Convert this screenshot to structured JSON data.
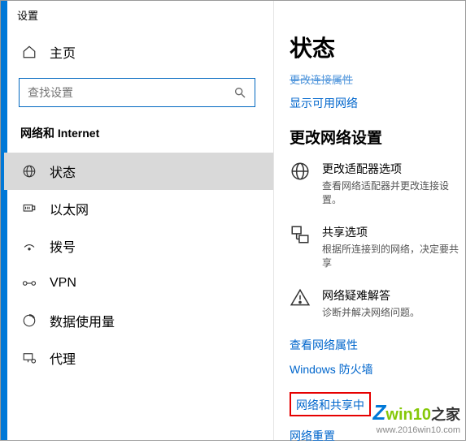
{
  "header": {
    "title": "设置"
  },
  "sidebar": {
    "home": "主页",
    "search_placeholder": "查找设置",
    "section": "网络和 Internet",
    "items": [
      {
        "label": "状态"
      },
      {
        "label": "以太网"
      },
      {
        "label": "拨号"
      },
      {
        "label": "VPN"
      },
      {
        "label": "数据使用量"
      },
      {
        "label": "代理"
      }
    ]
  },
  "main": {
    "heading": "状态",
    "link_change_conn": "更改连接属性",
    "link_show_networks": "显示可用网络",
    "section_heading": "更改网络设置",
    "options": [
      {
        "title": "更改适配器选项",
        "desc": "查看网络适配器并更改连接设置。"
      },
      {
        "title": "共享选项",
        "desc": "根据所连接到的网络，决定要共享"
      },
      {
        "title": "网络疑难解答",
        "desc": "诊断并解决网络问题。"
      }
    ],
    "link_props": "查看网络属性",
    "link_firewall": "Windows 防火墙",
    "link_sharing_center": "网络和共享中",
    "link_reset": "网络重置"
  },
  "watermark": {
    "url": "www.2016win10.com",
    "brand1": "win10",
    "brand2": "之家"
  }
}
